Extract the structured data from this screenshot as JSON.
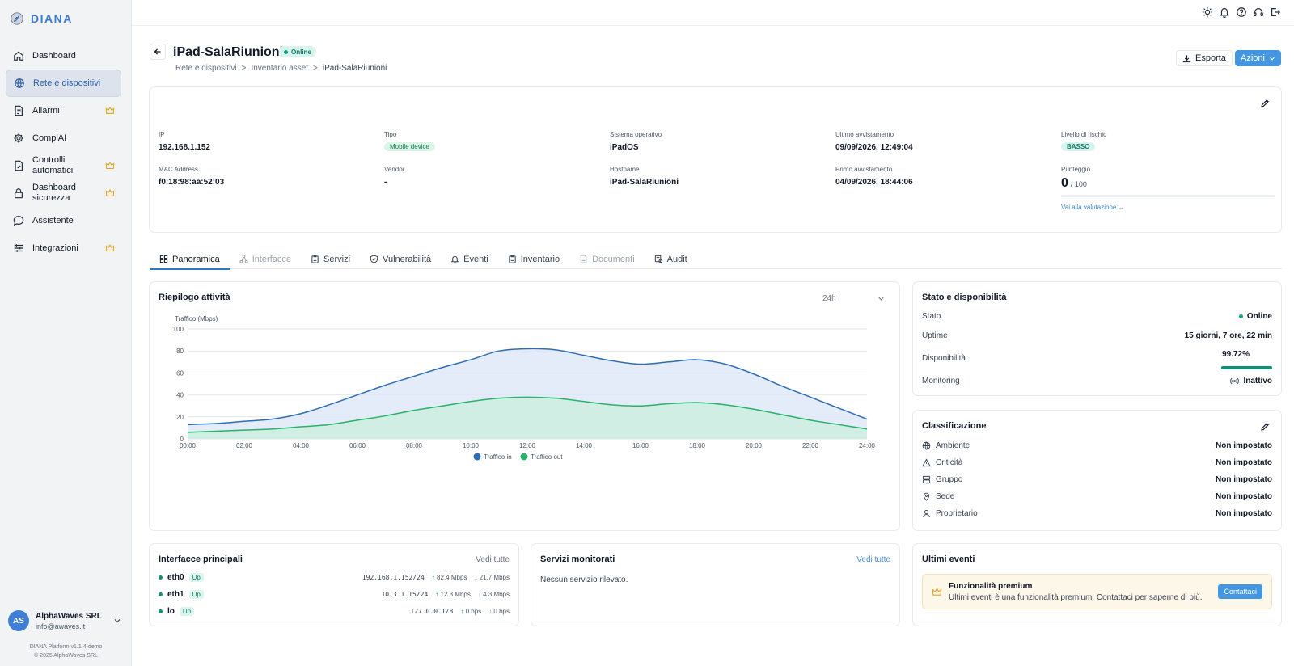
{
  "app": {
    "name": "DIANA"
  },
  "sidebar": {
    "items": [
      {
        "label": "Dashboard",
        "icon": "home-icon",
        "active": false,
        "premium": false
      },
      {
        "label": "Rete e dispositivi",
        "icon": "network-icon",
        "active": true,
        "premium": false
      },
      {
        "label": "Allarmi",
        "icon": "document-icon",
        "active": false,
        "premium": true
      },
      {
        "label": "ComplAI",
        "icon": "gear-icon",
        "active": false,
        "premium": false
      },
      {
        "label": "Controlli automatici",
        "icon": "file-check-icon",
        "active": false,
        "premium": true
      },
      {
        "label": "Dashboard sicurezza",
        "icon": "lock-icon",
        "active": false,
        "premium": true
      },
      {
        "label": "Assistente",
        "icon": "chat-icon",
        "active": false,
        "premium": false
      },
      {
        "label": "Integrazioni",
        "icon": "sliders-icon",
        "active": false,
        "premium": true
      }
    ],
    "user": {
      "initials": "AS",
      "name": "AlphaWaves SRL",
      "email": "info@awaves.it"
    },
    "version": "DIANA Platform v1.1.4-demo",
    "copyright": "© 2025 AlphaWaves SRL"
  },
  "header": {
    "title": "iPad-SalaRiunioni",
    "status": "Online",
    "breadcrumb": [
      "Rete e dispositivi",
      "Inventario asset",
      "iPad-SalaRiunioni"
    ],
    "export_label": "Esporta",
    "actions_label": "Azioni"
  },
  "info": {
    "ip": {
      "label": "IP",
      "value": "192.168.1.152"
    },
    "mac": {
      "label": "MAC Address",
      "value": "f0:18:98:aa:52:03"
    },
    "tipo": {
      "label": "Tipo",
      "value": "Mobile device"
    },
    "vendor": {
      "label": "Vendor",
      "value": "-"
    },
    "os": {
      "label": "Sistema operativo",
      "value": "iPadOS"
    },
    "hostname": {
      "label": "Hostname",
      "value": "iPad-SalaRiunioni"
    },
    "last_seen": {
      "label": "Ultimo avvistamento",
      "value": "09/09/2026, 12:49:04"
    },
    "first_seen": {
      "label": "Primo avvistamento",
      "value": "04/09/2026, 18:44:06"
    },
    "risk": {
      "label": "Livello di rischio",
      "value": "BASSO"
    },
    "score": {
      "label": "Punteggio",
      "value": "0",
      "max": "/ 100",
      "fraction": 0
    },
    "eval_link": "Vai alla valutazione →"
  },
  "tabs": [
    {
      "label": "Panoramica",
      "icon": "grid-icon",
      "active": true,
      "disabled": false
    },
    {
      "label": "Interfacce",
      "icon": "nodes-icon",
      "active": false,
      "disabled": true
    },
    {
      "label": "Servizi",
      "icon": "clipboard-icon",
      "active": false,
      "disabled": false
    },
    {
      "label": "Vulnerabilità",
      "icon": "shield-icon",
      "active": false,
      "disabled": false
    },
    {
      "label": "Eventi",
      "icon": "bell-icon",
      "active": false,
      "disabled": false
    },
    {
      "label": "Inventario",
      "icon": "clipboard-icon",
      "active": false,
      "disabled": false
    },
    {
      "label": "Documenti",
      "icon": "doc-icon",
      "active": false,
      "disabled": true
    },
    {
      "label": "Audit",
      "icon": "audit-icon",
      "active": false,
      "disabled": false
    }
  ],
  "activity": {
    "title": "Riepilogo attività",
    "range": "24h"
  },
  "chart_data": {
    "type": "area",
    "ylabel": "Traffico (Mbps)",
    "ylim": [
      0,
      100
    ],
    "yticks": [
      0,
      20,
      40,
      60,
      80,
      100
    ],
    "x": [
      "00:00",
      "01:00",
      "02:00",
      "03:00",
      "04:00",
      "05:00",
      "06:00",
      "07:00",
      "08:00",
      "09:00",
      "10:00",
      "11:00",
      "12:00",
      "13:00",
      "14:00",
      "15:00",
      "16:00",
      "17:00",
      "18:00",
      "19:00",
      "20:00",
      "21:00",
      "22:00",
      "23:00",
      "24:00"
    ],
    "xticks": [
      "00:00",
      "02:00",
      "04:00",
      "06:00",
      "08:00",
      "10:00",
      "12:00",
      "14:00",
      "16:00",
      "18:00",
      "20:00",
      "22:00",
      "24:00"
    ],
    "series": [
      {
        "name": "Traffico in",
        "color": "#2d6db5",
        "fill": "#dfe8f8",
        "values": [
          13,
          14,
          16,
          18,
          23,
          31,
          40,
          49,
          57,
          65,
          72,
          80,
          82,
          81,
          76,
          71,
          68,
          70,
          72,
          68,
          59,
          48,
          38,
          28,
          18
        ]
      },
      {
        "name": "Traffico out",
        "color": "#28b26a",
        "fill": "#cdeee0",
        "values": [
          6,
          7,
          8,
          9,
          11,
          13,
          17,
          21,
          26,
          30,
          34,
          37,
          38,
          37,
          34,
          31,
          30,
          32,
          33,
          31,
          27,
          22,
          17,
          13,
          9
        ]
      }
    ],
    "legend": "bottom-center",
    "grid": true
  },
  "status": {
    "title": "Stato e disponibilità",
    "rows": [
      {
        "label": "Stato",
        "value": "Online"
      },
      {
        "label": "Uptime",
        "value": "15 giorni, 7 ore, 22 min"
      },
      {
        "label": "Disponibilità",
        "value": "99.72%",
        "fraction": 0.9972
      },
      {
        "label": "Monitoring",
        "value": "Inattivo"
      }
    ]
  },
  "classification": {
    "title": "Classificazione",
    "rows": [
      {
        "label": "Ambiente",
        "icon": "globe-icon",
        "value": "Non impostato"
      },
      {
        "label": "Criticità",
        "icon": "warning-icon",
        "value": "Non impostato"
      },
      {
        "label": "Gruppo",
        "icon": "server-icon",
        "value": "Non impostato"
      },
      {
        "label": "Sede",
        "icon": "pin-icon",
        "value": "Non impostato"
      },
      {
        "label": "Proprietario",
        "icon": "user-icon",
        "value": "Non impostato"
      }
    ]
  },
  "interfaces": {
    "title": "Interfacce principali",
    "see_all": "Vedi tutte",
    "rows": [
      {
        "name": "eth0",
        "status": "Up",
        "ip": "192.168.1.152/24",
        "in": "82.4 Mbps",
        "out": "21.7 Mbps"
      },
      {
        "name": "eth1",
        "status": "Up",
        "ip": "10.3.1.15/24",
        "in": "12.3 Mbps",
        "out": "4.3 Mbps"
      },
      {
        "name": "lo",
        "status": "Up",
        "ip": "127.0.0.1/8",
        "in": "0 bps",
        "out": "0 bps"
      }
    ]
  },
  "services": {
    "title": "Servizi monitorati",
    "see_all": "Vedi tutte",
    "empty": "Nessun servizio rilevato."
  },
  "events": {
    "title": "Ultimi eventi",
    "premium_title": "Funzionalità premium",
    "premium_text": "Ultimi eventi è una funzionalità premium. Contattaci per saperne di più.",
    "contact_label": "Contattaci"
  }
}
